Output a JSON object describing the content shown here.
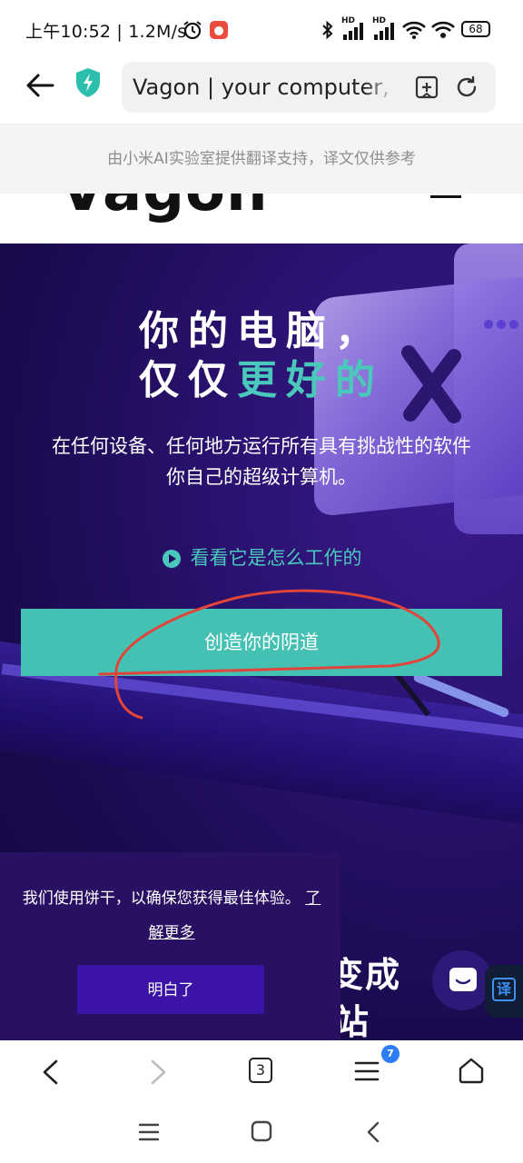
{
  "status": {
    "time": "上午10:52 | 1.2M/s",
    "battery": "68",
    "hd1": "HD",
    "hd2": "HD"
  },
  "browser": {
    "url_text": "Vagon | your computer, just better",
    "banner": "由小米AI实验室提供翻译支持，译文仅供参考",
    "tabs_count": "3",
    "menu_badge": "7"
  },
  "site": {
    "logo": "Vagon",
    "hero": {
      "title_line1": "你的电脑，",
      "title_line2_a": "仅仅",
      "title_line2_b": "更好的",
      "subtitle_line1": "在任何设备、任何地方运行所有具有挑战性的软件",
      "subtitle_line2": "你自己的超级计算机。",
      "how_it_works": "看看它是怎么工作的",
      "cta": "创造你的阴道"
    },
    "partial_text_1": "变成",
    "partial_text_2": "站"
  },
  "cookie": {
    "message": "我们使用饼干，以确保您获得最佳体验。",
    "learn_more": "了解更多",
    "ok": "明白了"
  },
  "translate_label": "译",
  "colors": {
    "accent": "#45c1b3",
    "hero_bg": "#1a0a4e",
    "cookie_bg": "#2a1063",
    "cookie_button": "#3b13a6",
    "scribble": "#e0443a"
  }
}
